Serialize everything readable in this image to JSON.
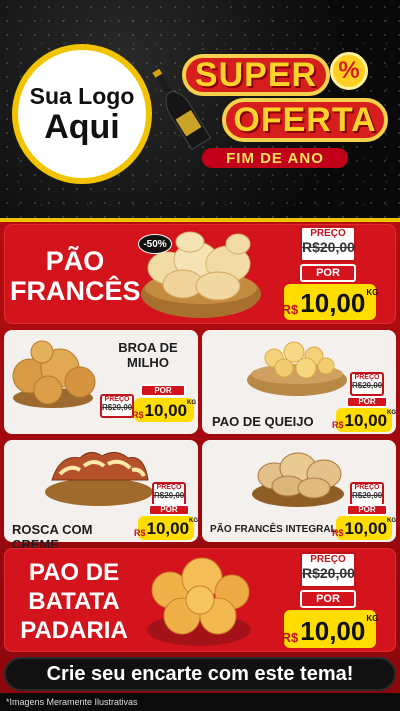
{
  "logo": {
    "line1": "Sua Logo",
    "line2": "Aqui"
  },
  "banner": {
    "super": "SUPER",
    "oferta": "OFERTA",
    "fim": "FIM DE ANO",
    "percent": "%"
  },
  "featured1": {
    "title_line1": "PÃO",
    "title_line2": "FRANCÊS",
    "discount": "-50%",
    "preco_label": "PREÇO",
    "old_price": "R$20,00",
    "por_label": "POR",
    "currency": "R$",
    "price": "10,00",
    "unit": "KG"
  },
  "products": [
    {
      "title_line1": "BROA DE",
      "title_line2": "MILHO",
      "preco_label": "PREÇO",
      "old_price": "R$20,00",
      "por_label": "POR",
      "currency": "R$",
      "price": "10,00",
      "unit": "KG"
    },
    {
      "title": "PAO DE QUEIJO",
      "preco_label": "PREÇO",
      "old_price": "R$20,00",
      "por_label": "POR",
      "currency": "R$",
      "price": "10,00",
      "unit": "KG"
    },
    {
      "title": "ROSCA COM CREME",
      "preco_label": "PREÇO",
      "old_price": "R$20,00",
      "por_label": "POR",
      "currency": "R$",
      "price": "10,00",
      "unit": "KG"
    },
    {
      "title": "PÃO FRANCÊS INTEGRAL",
      "preco_label": "PREÇO",
      "old_price": "R$20,00",
      "por_label": "POR",
      "currency": "R$",
      "price": "10,00",
      "unit": "KG"
    }
  ],
  "featured2": {
    "title_line1": "PAO DE",
    "title_line2": "BATATA",
    "title_line3": "PADARIA",
    "preco_label": "PREÇO",
    "old_price": "R$20,00",
    "por_label": "POR",
    "currency": "R$",
    "price": "10,00",
    "unit": "KG"
  },
  "cta": "Crie seu encarte com este tema!",
  "footer": "*Imagens Meramente Ilustrativas",
  "colors": {
    "red": "#d4141c",
    "yellow": "#ffdd00",
    "dark": "#0b0b0b"
  },
  "icons": [
    "wine-bottle-icon",
    "percent-icon"
  ]
}
